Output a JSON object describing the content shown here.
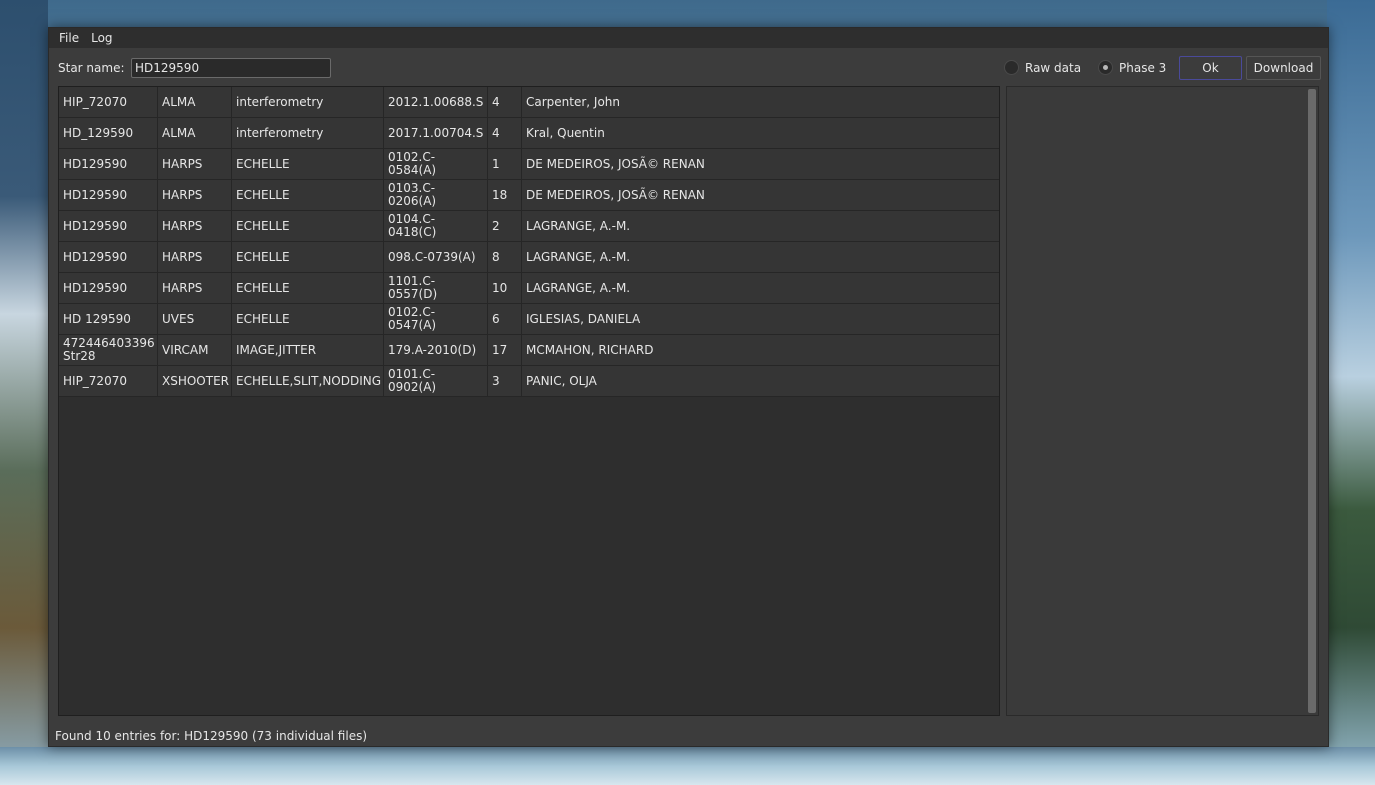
{
  "menu": {
    "file": "File",
    "log": "Log"
  },
  "search": {
    "label": "Star name:",
    "value": "HD129590"
  },
  "options": {
    "raw_data": "Raw data",
    "phase3": "Phase 3",
    "selected": "phase3"
  },
  "buttons": {
    "ok": "Ok",
    "download": "Download"
  },
  "table": {
    "rows": [
      [
        "HIP_72070",
        "ALMA",
        "interferometry",
        "2012.1.00688.S",
        "4",
        "Carpenter, John"
      ],
      [
        "HD_129590",
        "ALMA",
        "interferometry",
        "2017.1.00704.S",
        "4",
        "Kral, Quentin"
      ],
      [
        "HD129590",
        "HARPS",
        "ECHELLE",
        "0102.C-0584(A)",
        "1",
        "DE MEDEIROS, JOSÃ© RENAN"
      ],
      [
        "HD129590",
        "HARPS",
        "ECHELLE",
        "0103.C-0206(A)",
        "18",
        "DE MEDEIROS, JOSÃ© RENAN"
      ],
      [
        "HD129590",
        "HARPS",
        "ECHELLE",
        "0104.C-0418(C)",
        "2",
        "LAGRANGE, A.-M."
      ],
      [
        "HD129590",
        "HARPS",
        "ECHELLE",
        "098.C-0739(A)",
        "8",
        "LAGRANGE, A.-M."
      ],
      [
        "HD129590",
        "HARPS",
        "ECHELLE",
        "1101.C-0557(D)",
        "10",
        "LAGRANGE, A.-M."
      ],
      [
        "HD 129590",
        "UVES",
        "ECHELLE",
        "0102.C-0547(A)",
        "6",
        "IGLESIAS, DANIELA"
      ],
      [
        "472446403396\nStr28",
        "VIRCAM",
        "IMAGE,JITTER",
        "179.A-2010(D)",
        "17",
        "MCMAHON, RICHARD"
      ],
      [
        "HIP_72070",
        "XSHOOTER",
        "ECHELLE,SLIT,NODDING",
        "0101.C-0902(A)",
        "3",
        "PANIC, OLJA"
      ]
    ]
  },
  "status": "Found 10 entries for: HD129590 (73 individual files)"
}
